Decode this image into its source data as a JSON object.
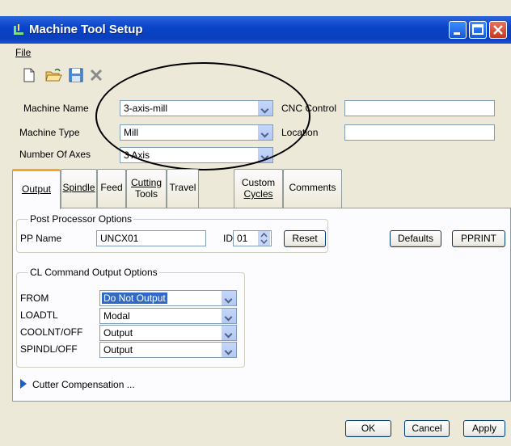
{
  "window": {
    "title": "Machine Tool Setup"
  },
  "menu": {
    "file": "File"
  },
  "toolbar": {
    "new": "new-icon",
    "open": "open-folder-icon",
    "save": "save-icon",
    "delete": "delete-icon"
  },
  "form": {
    "machine_name_label": "Machine Name",
    "machine_name_value": "3-axis-mill",
    "machine_type_label": "Machine Type",
    "machine_type_value": "Mill",
    "num_axes_label": "Number Of Axes",
    "num_axes_value": "3 Axis",
    "cnc_control_label": "CNC Control",
    "cnc_control_value": "",
    "location_label": "Location",
    "location_value": ""
  },
  "tabs": [
    {
      "label": "Output"
    },
    {
      "label": "Spindle"
    },
    {
      "label": "Feed"
    },
    {
      "label_line1": "Cutting",
      "label_line2": "Tools"
    },
    {
      "label": "Travel"
    },
    {
      "label_line1": "Custom",
      "label_line2": "Cycles"
    },
    {
      "label": "Comments"
    }
  ],
  "post_processor": {
    "group_title": "Post Processor Options",
    "pp_name_label": "PP Name",
    "pp_name_value": "UNCX01",
    "id_label": "ID",
    "id_value": "01",
    "reset_label": "Reset",
    "defaults_label": "Defaults",
    "pprint_label": "PPRINT"
  },
  "cl_options": {
    "group_title": "CL Command Output Options",
    "rows": [
      {
        "label": "FROM",
        "value": "Do Not Output"
      },
      {
        "label": "LOADTL",
        "value": "Modal"
      },
      {
        "label": "COOLNT/OFF",
        "value": "Output"
      },
      {
        "label": "SPINDL/OFF",
        "value": "Output"
      }
    ]
  },
  "cutter_comp": {
    "label": "Cutter Compensation ..."
  },
  "footer": {
    "ok": "OK",
    "cancel": "Cancel",
    "apply": "Apply"
  },
  "colors": {
    "title_bar": "#0a44c8",
    "selection": "#316ac5",
    "active_tab": "#f5a623"
  }
}
